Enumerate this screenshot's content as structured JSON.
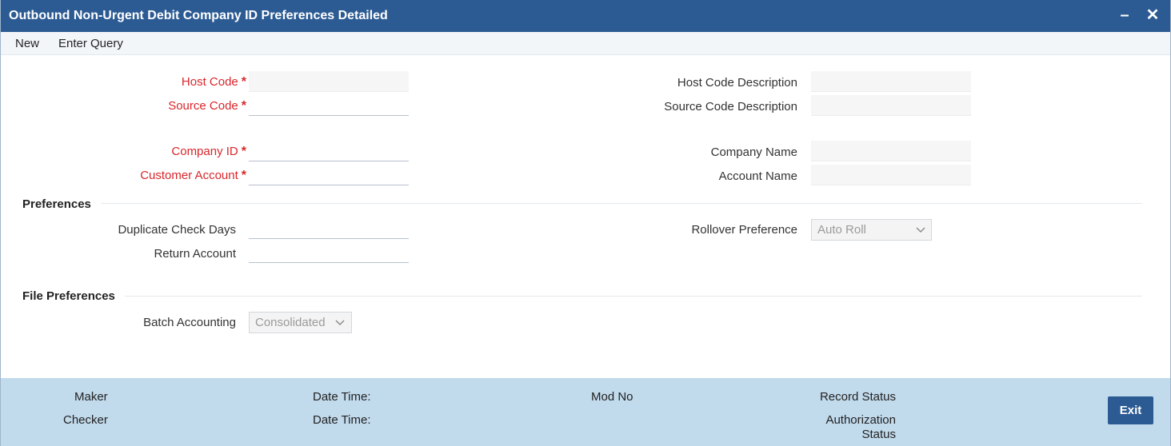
{
  "window": {
    "title": "Outbound Non-Urgent Debit Company ID Preferences Detailed",
    "minimize_symbol": "–",
    "close_symbol": "✕"
  },
  "menu": {
    "new": "New",
    "enter_query": "Enter Query"
  },
  "form": {
    "host_code": {
      "label": "Host Code",
      "required_mark": "*",
      "value": ""
    },
    "source_code": {
      "label": "Source Code",
      "required_mark": "*",
      "value": ""
    },
    "company_id": {
      "label": "Company ID",
      "required_mark": "*",
      "value": ""
    },
    "customer_account": {
      "label": "Customer Account",
      "required_mark": "*",
      "value": ""
    },
    "host_code_description": {
      "label": "Host Code Description",
      "value": ""
    },
    "source_code_description": {
      "label": "Source Code Description",
      "value": ""
    },
    "company_name": {
      "label": "Company Name",
      "value": ""
    },
    "account_name": {
      "label": "Account Name",
      "value": ""
    }
  },
  "preferences": {
    "heading": "Preferences",
    "duplicate_check_days": {
      "label": "Duplicate Check Days",
      "value": ""
    },
    "return_account": {
      "label": "Return Account",
      "value": ""
    },
    "rollover_preference": {
      "label": "Rollover Preference",
      "value": "Auto Roll"
    }
  },
  "file_preferences": {
    "heading": "File Preferences",
    "batch_accounting": {
      "label": "Batch Accounting",
      "value": "Consolidated"
    }
  },
  "footer": {
    "maker": "Maker",
    "checker": "Checker",
    "date_time_1": "Date Time:",
    "date_time_2": "Date Time:",
    "mod_no": "Mod No",
    "record_status": "Record Status",
    "authorization_status_line1": "Authorization",
    "authorization_status_line2": "Status",
    "exit": "Exit"
  },
  "colors": {
    "titlebar": "#2c5b93",
    "required": "#d9262b",
    "footer": "#c1daec"
  }
}
